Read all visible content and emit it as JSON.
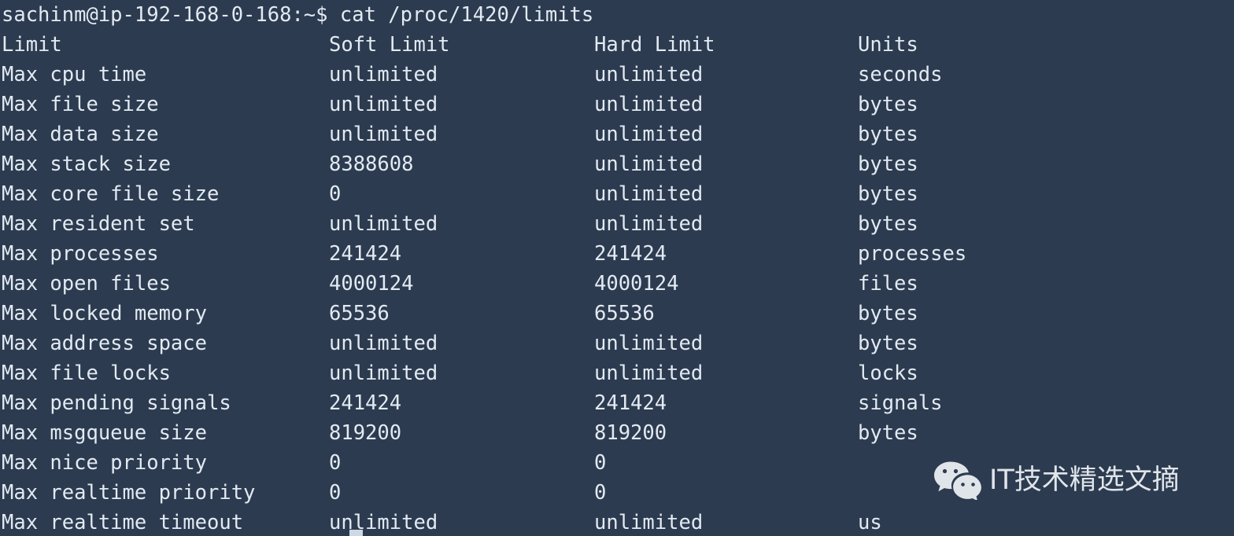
{
  "terminal": {
    "background_color": "#2d3b50",
    "text_color": "#e2eaf2",
    "prompt": "sachinm@ip-192-168-0-168:~$ cat /proc/1420/limits",
    "headers": {
      "limit": "Limit",
      "soft": "Soft Limit",
      "hard": "Hard Limit",
      "units": "Units"
    },
    "rows": [
      {
        "limit": "Max cpu time",
        "soft": "unlimited",
        "hard": "unlimited",
        "units": "seconds"
      },
      {
        "limit": "Max file size",
        "soft": "unlimited",
        "hard": "unlimited",
        "units": "bytes"
      },
      {
        "limit": "Max data size",
        "soft": "unlimited",
        "hard": "unlimited",
        "units": "bytes"
      },
      {
        "limit": "Max stack size",
        "soft": "8388608",
        "hard": "unlimited",
        "units": "bytes"
      },
      {
        "limit": "Max core file size",
        "soft": "0",
        "hard": "unlimited",
        "units": "bytes"
      },
      {
        "limit": "Max resident set",
        "soft": "unlimited",
        "hard": "unlimited",
        "units": "bytes"
      },
      {
        "limit": "Max processes",
        "soft": "241424",
        "hard": "241424",
        "units": "processes"
      },
      {
        "limit": "Max open files",
        "soft": "4000124",
        "hard": "4000124",
        "units": "files"
      },
      {
        "limit": "Max locked memory",
        "soft": "65536",
        "hard": "65536",
        "units": "bytes"
      },
      {
        "limit": "Max address space",
        "soft": "unlimited",
        "hard": "unlimited",
        "units": "bytes"
      },
      {
        "limit": "Max file locks",
        "soft": "unlimited",
        "hard": "unlimited",
        "units": "locks"
      },
      {
        "limit": "Max pending signals",
        "soft": "241424",
        "hard": "241424",
        "units": "signals"
      },
      {
        "limit": "Max msgqueue size",
        "soft": "819200",
        "hard": "819200",
        "units": "bytes"
      },
      {
        "limit": "Max nice priority",
        "soft": "0",
        "hard": "0",
        "units": ""
      },
      {
        "limit": "Max realtime priority",
        "soft": "0",
        "hard": "0",
        "units": ""
      },
      {
        "limit": "Max realtime timeout",
        "soft": "unlimited",
        "hard": "unlimited",
        "units": "us"
      }
    ]
  },
  "watermark": {
    "icon": "wechat-logo-icon",
    "text": "IT技术精选文摘",
    "color": "#eef2f6"
  }
}
